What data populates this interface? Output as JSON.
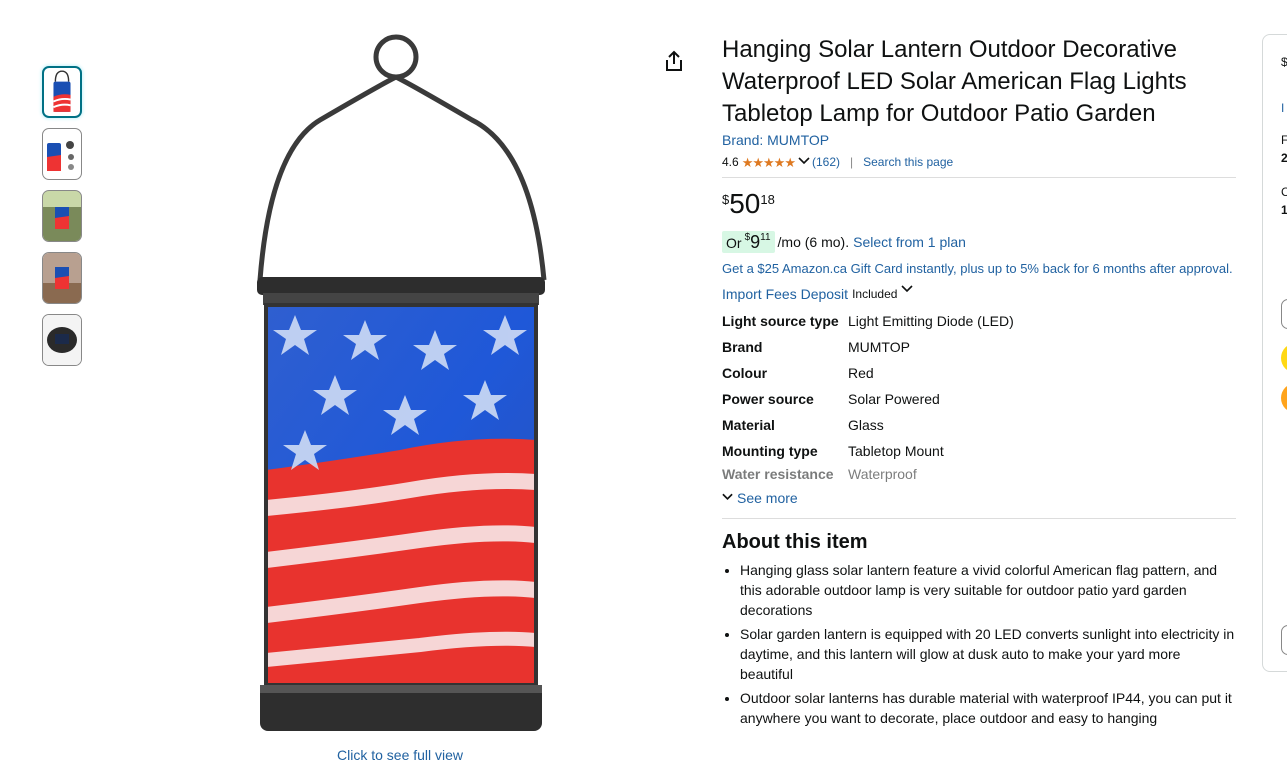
{
  "product": {
    "title": "Hanging Solar Lantern Outdoor Decorative Waterproof LED Solar American Flag Lights Tabletop Lamp for Outdoor Patio Garden",
    "brand_link": "Brand: MUMTOP",
    "rating": "4.6",
    "rating_stars": 4.5,
    "review_count": "(162)",
    "search_page": "Search this page",
    "price": {
      "symbol": "$",
      "whole": "50",
      "fraction": "18"
    },
    "monthly": {
      "or": "Or",
      "symbol": "$",
      "whole": "9",
      "fraction": "11",
      "term": "/mo (6 mo).",
      "select": "Select from 1 plan"
    },
    "gift_offer": "Get a $25 Amazon.ca Gift Card instantly, plus up to 5% back for 6 months after approval.",
    "import_fees": {
      "label": "Import Fees Deposit",
      "status": "Included"
    },
    "specs": [
      {
        "key": "Light source type",
        "value": "Light Emitting Diode (LED)"
      },
      {
        "key": "Brand",
        "value": "MUMTOP"
      },
      {
        "key": "Colour",
        "value": "Red"
      },
      {
        "key": "Power source",
        "value": "Solar Powered"
      },
      {
        "key": "Material",
        "value": "Glass"
      },
      {
        "key": "Mounting type",
        "value": "Tabletop Mount"
      },
      {
        "key": "Water resistance",
        "value": "Waterproof"
      }
    ],
    "see_more": "See more",
    "about": {
      "heading": "About this item",
      "bullets": [
        "Hanging glass solar lantern feature a vivid colorful American flag pattern, and this adorable outdoor lamp is very suitable for outdoor patio yard garden decorations",
        "Solar garden lantern is equipped with 20 LED converts sunlight into electricity in daytime, and this lantern will glow at dusk auto to make your yard more beautiful",
        "Outdoor solar lanterns has durable material with waterproof IP44, you can put it anywhere you want to decorate, place outdoor and easy to hanging"
      ]
    }
  },
  "gallery": {
    "thumbnails": [
      "thumb-1",
      "thumb-2",
      "thumb-3",
      "thumb-4",
      "thumb-5"
    ],
    "full_view": "Click to see full view"
  },
  "buybox_partial": [
    "$",
    "I",
    "F",
    "2",
    "C",
    "1"
  ],
  "icons": {
    "share": "share-icon",
    "chevron": "chevron-down-icon",
    "star": "star-icon"
  },
  "colors": {
    "link": "#2162A1",
    "star": "#DE7921",
    "deal_bg": "#d7f7e4",
    "thumb_active": "#007185"
  }
}
